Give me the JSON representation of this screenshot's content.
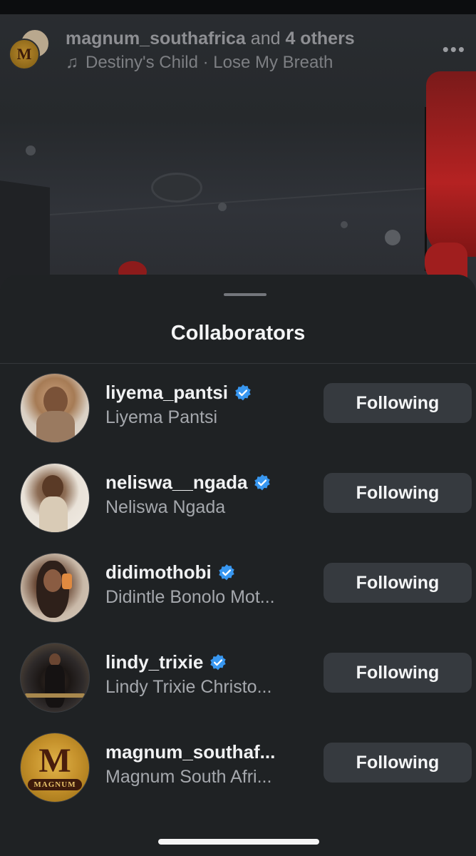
{
  "video": {
    "header": {
      "primary_user": "magnum_southafrica",
      "connector": " and ",
      "others": "4 others",
      "song": "Destiny's Child · Lose My Breath",
      "avatar_text": "M",
      "more_icon": "more-icon"
    }
  },
  "sheet": {
    "title": "Collaborators",
    "rows": [
      {
        "username": "liyema_pantsi",
        "name": "Liyema Pantsi",
        "verified": true,
        "button": "Following"
      },
      {
        "username": "neliswa__ngada",
        "name": "Neliswa Ngada",
        "verified": true,
        "button": "Following"
      },
      {
        "username": "didimothobi",
        "name": "Didintle Bonolo Mot...",
        "verified": true,
        "button": "Following"
      },
      {
        "username": "lindy_trixie",
        "name": "Lindy Trixie Christo...",
        "verified": true,
        "button": "Following"
      },
      {
        "username": "magnum_southaf...",
        "name": "Magnum South Afri...",
        "verified": false,
        "button": "Following",
        "avatar_mark": "M",
        "avatar_brand": "MAGNUM"
      }
    ]
  },
  "colors": {
    "sheet_bg": "#1f2224",
    "button_bg": "#363a3f",
    "verified_blue": "#3897f0",
    "text_primary": "#f1f2f3",
    "text_secondary": "#a5a8ad"
  }
}
